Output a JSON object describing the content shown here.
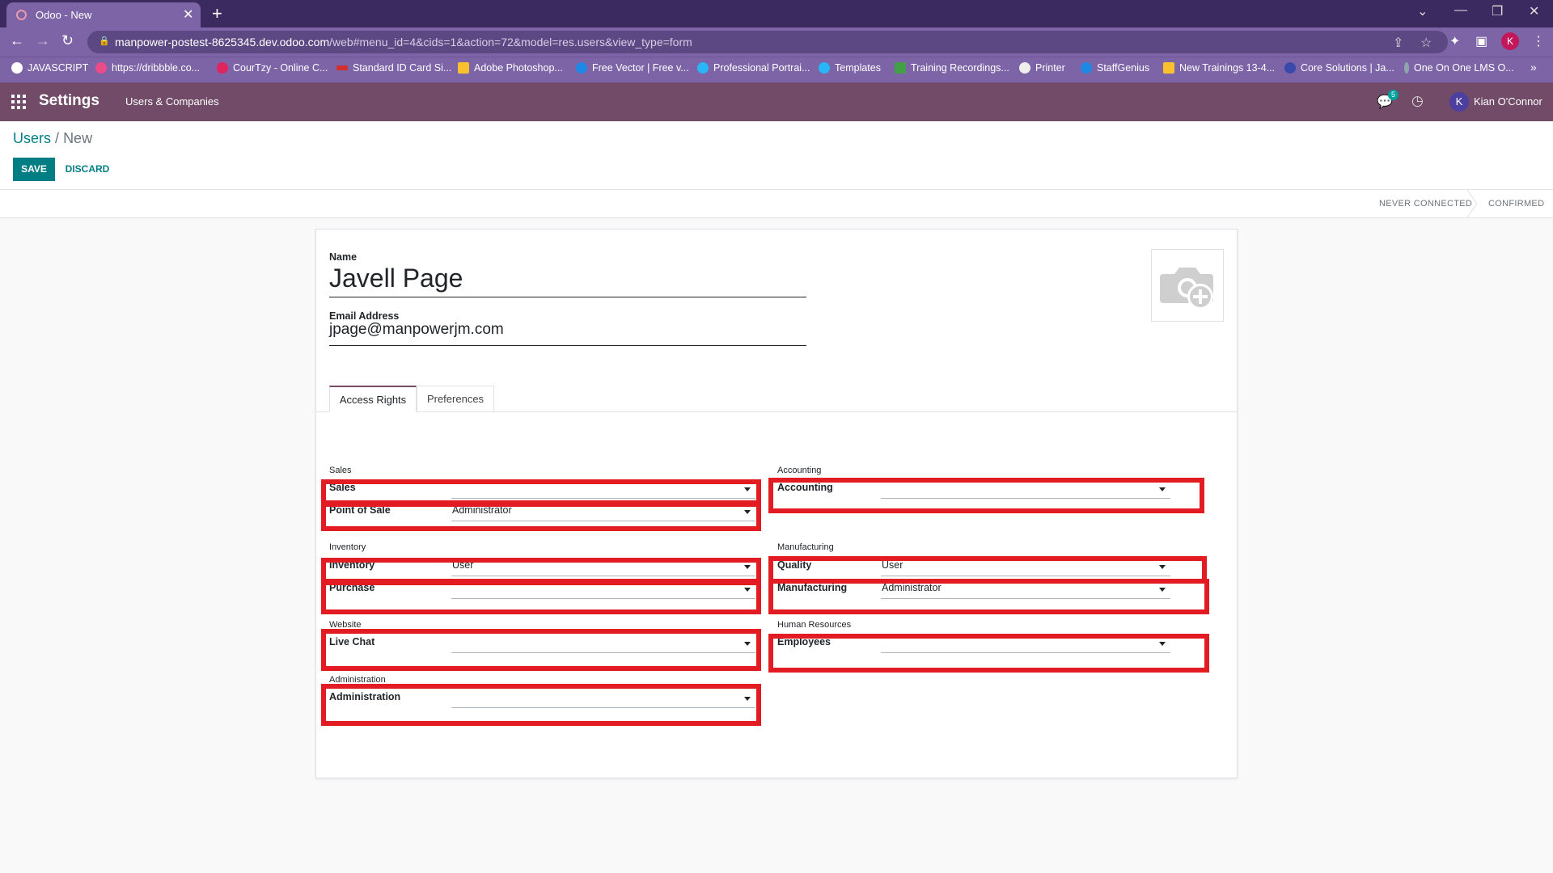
{
  "browser": {
    "tab_title": "Odoo - New",
    "new_tab_icon": "plus-icon",
    "url_host": "manpower-postest-8625345.dev.odoo.com",
    "url_path": "/web#menu_id=4&cids=1&action=72&model=res.users&view_type=form",
    "profile_initial": "K",
    "bookmarks": [
      {
        "label": "JAVASCRIPT",
        "color": "#ffffff"
      },
      {
        "label": "https://dribbble.co...",
        "color": "#ea4c89"
      },
      {
        "label": "CourTzy - Online C...",
        "color": "#e0245e"
      },
      {
        "label": "Standard ID Card Si...",
        "color": "#d32f2f"
      },
      {
        "label": "Adobe Photoshop...",
        "color": "#fbc02d"
      },
      {
        "label": "Free Vector | Free v...",
        "color": "#1e88e5"
      },
      {
        "label": "Professional Portrai...",
        "color": "#29b6f6"
      },
      {
        "label": "Templates",
        "color": "#29b6f6"
      },
      {
        "label": "Training Recordings...",
        "color": "#43a047"
      },
      {
        "label": "Printer",
        "color": "#eeeeee"
      },
      {
        "label": "StaffGenius",
        "color": "#1e88e5"
      },
      {
        "label": "New Trainings 13-4...",
        "color": "#fbc02d"
      },
      {
        "label": "Core Solutions | Ja...",
        "color": "#3949ab"
      },
      {
        "label": "One On One LMS O...",
        "color": "#90a4ae"
      }
    ],
    "bookmarks_overflow": "»"
  },
  "navbar": {
    "brand": "Settings",
    "menu": "Users & Companies",
    "chat_count": "5",
    "user_initial": "K",
    "user_name": "Kian O'Connor",
    "color": "#714b67"
  },
  "control_panel": {
    "breadcrumb_parent": "Users",
    "breadcrumb_sep": "/",
    "breadcrumb_current": "New",
    "save_label": "SAVE",
    "discard_label": "DISCARD",
    "stages": [
      "NEVER CONNECTED",
      "CONFIRMED"
    ]
  },
  "form": {
    "name_label": "Name",
    "name_value": "Javell Page",
    "email_label": "Email Address",
    "email_value": "jpage@manpowerjm.com",
    "avatar_icon": "camera-plus-icon",
    "tabs": [
      "Access Rights",
      "Preferences"
    ],
    "left_sections": [
      {
        "title": "Sales",
        "fields": [
          {
            "label": "Sales",
            "value": ""
          },
          {
            "label": "Point of Sale",
            "value": "Administrator"
          }
        ]
      },
      {
        "title": "Inventory",
        "fields": [
          {
            "label": "Inventory",
            "value": "User"
          },
          {
            "label": "Purchase",
            "value": ""
          }
        ]
      },
      {
        "title": "Website",
        "fields": [
          {
            "label": "Live Chat",
            "value": ""
          }
        ]
      },
      {
        "title": "Administration",
        "fields": [
          {
            "label": "Administration",
            "value": ""
          }
        ]
      }
    ],
    "right_sections": [
      {
        "title": "Accounting",
        "fields": [
          {
            "label": "Accounting",
            "value": ""
          }
        ]
      },
      {
        "title": "Manufacturing",
        "fields": [
          {
            "label": "Quality",
            "value": "User"
          },
          {
            "label": "Manufacturing",
            "value": "Administrator"
          }
        ]
      },
      {
        "title": "Human Resources",
        "fields": [
          {
            "label": "Employees",
            "value": ""
          }
        ]
      }
    ],
    "highlight_color": "#e31b23"
  }
}
